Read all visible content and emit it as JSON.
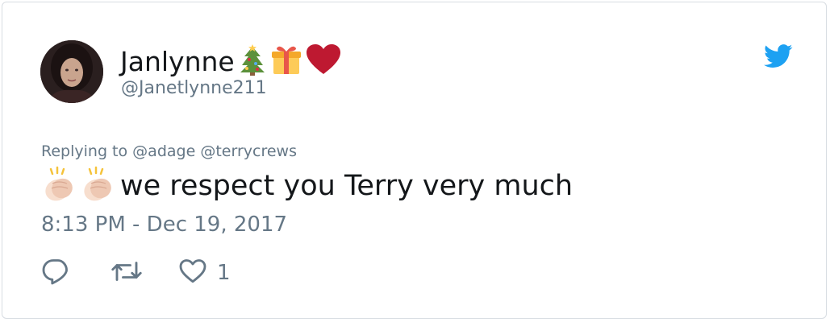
{
  "tweet": {
    "display_name": "Janlynne",
    "name_emojis": [
      "christmas-tree",
      "gift",
      "red-heart"
    ],
    "handle": "@Janetlynne211",
    "replying_prefix": "Replying to",
    "replying_mentions": [
      "@adage",
      "@terrycrews"
    ],
    "text_emojis": [
      "clapping-hands",
      "clapping-hands"
    ],
    "text": "we respect you Terry very much",
    "timestamp": "8:13 PM - Dec 19, 2017",
    "like_count": "1"
  },
  "icons": {
    "reply": "reply-icon",
    "retweet": "retweet-icon",
    "like": "heart-icon",
    "brand": "twitter-bird-icon"
  },
  "colors": {
    "text_primary": "#14171a",
    "text_secondary": "#657786",
    "twitter_blue": "#1da1f2",
    "border": "#d8dde2"
  }
}
